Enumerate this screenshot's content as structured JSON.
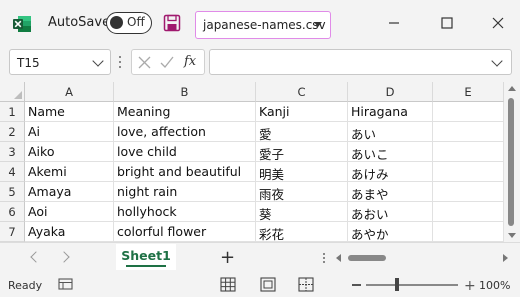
{
  "titlebar": {
    "autosave_label": "AutoSave",
    "autosave_state": "Off",
    "filename": "japanese-names.csv"
  },
  "formula_bar": {
    "name_box": "T15",
    "fx_label": "fx",
    "formula_value": ""
  },
  "columns": [
    "A",
    "B",
    "C",
    "D",
    "E"
  ],
  "rows": [
    {
      "n": "1",
      "cells": [
        "Name",
        "Meaning",
        "Kanji",
        "Hiragana",
        ""
      ]
    },
    {
      "n": "2",
      "cells": [
        "Ai",
        "love, affection",
        "愛",
        "あい",
        ""
      ]
    },
    {
      "n": "3",
      "cells": [
        "Aiko",
        "love child",
        "愛子",
        "あいこ",
        ""
      ]
    },
    {
      "n": "4",
      "cells": [
        "Akemi",
        "bright and beautiful",
        "明美",
        "あけみ",
        ""
      ]
    },
    {
      "n": "5",
      "cells": [
        "Amaya",
        "night rain",
        "雨夜",
        "あまや",
        ""
      ]
    },
    {
      "n": "6",
      "cells": [
        "Aoi",
        "hollyhock",
        "葵",
        "あおい",
        ""
      ]
    },
    {
      "n": "7",
      "cells": [
        "Ayaka",
        "colorful flower",
        "彩花",
        "あやか",
        ""
      ]
    }
  ],
  "sheets": [
    "Sheet1"
  ],
  "status": {
    "ready": "Ready",
    "zoom": "100%"
  },
  "colors": {
    "excel_green": "#1e7145",
    "filename_border": "#e08be8",
    "save_icon": "#a0196e"
  }
}
